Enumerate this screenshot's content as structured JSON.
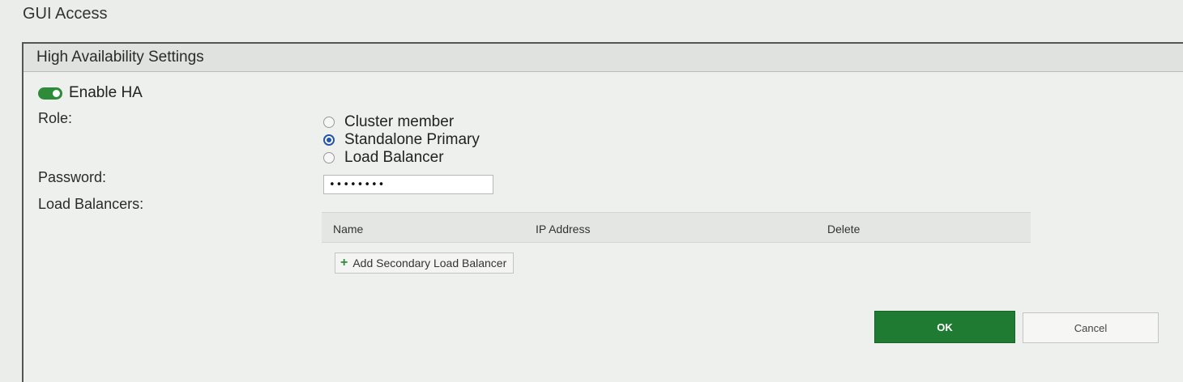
{
  "section": {
    "title": "GUI Access"
  },
  "panel": {
    "title": "High Availability Settings",
    "enable_ha": {
      "label": "Enable HA",
      "enabled": true
    },
    "role": {
      "label": "Role:",
      "options": [
        {
          "label": "Cluster member",
          "selected": false
        },
        {
          "label": "Standalone Primary",
          "selected": true
        },
        {
          "label": "Load Balancer",
          "selected": false
        }
      ]
    },
    "password": {
      "label": "Password:",
      "value": "••••••••"
    },
    "load_balancers": {
      "label": "Load Balancers:",
      "columns": [
        "Name",
        "IP Address",
        "Delete"
      ],
      "add_button_label": "Add Secondary Load Balancer"
    }
  },
  "actions": {
    "ok_label": "OK",
    "cancel_label": "Cancel"
  },
  "colors": {
    "accent": "#1f7a32",
    "radio_selected": "#2255aa"
  }
}
